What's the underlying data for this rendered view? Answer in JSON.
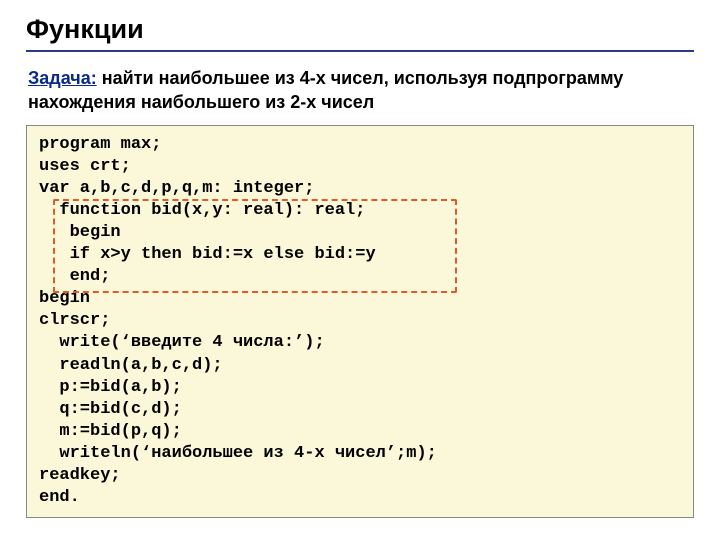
{
  "title": "Функции",
  "task": {
    "label": "Задача:",
    "text": " найти наибольшее из 4-х чисел, используя подпрограмму нахождения наибольшего из 2-х чисел"
  },
  "code": {
    "l1": "program max;",
    "l2": "uses crt;",
    "l3": "var a,b,c,d,p,q,m: integer;",
    "l4": "  function bid(x,y: real): real;",
    "l5": "   begin",
    "l6": "   if x>y then bid:=x else bid:=y",
    "l7": "   end;",
    "l8": "begin",
    "l9": "clrscr;",
    "l10": "  write(‘введите 4 числа:’);",
    "l11": "  readln(a,b,c,d);",
    "l12": "  p:=bid(a,b);",
    "l13": "  q:=bid(c,d);",
    "l14": "  m:=bid(p,q);",
    "l15": "  writeln(‘наибольшее из 4-х чисел’;m);",
    "l16": "readkey;",
    "l17": "end."
  }
}
